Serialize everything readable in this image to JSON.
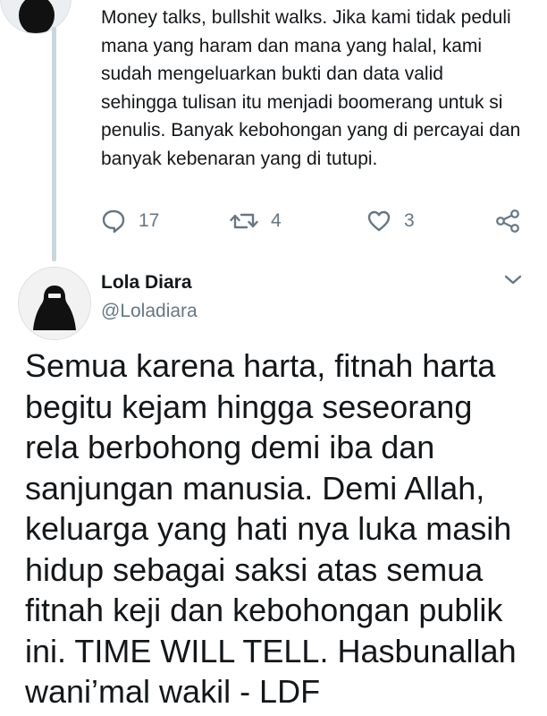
{
  "previous_tweet": {
    "text": "Money talks, bullshit walks. Jika kami tidak peduli mana yang haram dan mana yang halal, kami sudah mengeluarkan bukti dan data valid sehingga tulisan itu menjadi boomerang untuk si penulis. Banyak kebohongan yang di percayai dan banyak kebenaran yang di tutupi.",
    "actions": {
      "reply_count": "17",
      "retweet_count": "4",
      "like_count": "3",
      "reply_icon": "reply-icon",
      "retweet_icon": "retweet-icon",
      "like_icon": "heart-icon",
      "share_icon": "share-icon"
    }
  },
  "main_tweet": {
    "author_name": "Lola Diara",
    "author_handle": "@Loladiara",
    "menu_icon": "chevron-down-icon",
    "avatar_signature": "Lola Diara",
    "text": "Semua karena harta, fitnah harta begitu kejam hingga seseorang rela berbohong demi iba dan sanjungan manusia. Demi Allah, keluarga yang hati nya luka masih hidup sebagai saksi atas semua fitnah keji dan kebohongan publik ini. TIME WILL TELL. Hasbunallah wani’mal wakil - LDF"
  },
  "colors": {
    "text": "#14171a",
    "secondary": "#657786",
    "thread_line": "#ccd6dd"
  }
}
